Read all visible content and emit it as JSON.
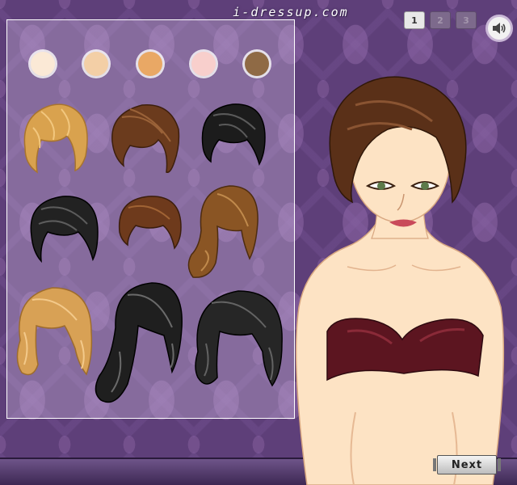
{
  "site": {
    "logo_text": "i-dressup.com"
  },
  "pager": {
    "pages": [
      "1",
      "2",
      "3"
    ],
    "active": "1"
  },
  "sound": {
    "icon": "speaker-icon"
  },
  "panel": {
    "skin_tones": [
      {
        "name": "skin-tone-1",
        "color": "#fbe9d6"
      },
      {
        "name": "skin-tone-2",
        "color": "#f3cfa6"
      },
      {
        "name": "skin-tone-3",
        "color": "#e9a865"
      },
      {
        "name": "skin-tone-4",
        "color": "#f8cfcc"
      },
      {
        "name": "skin-tone-5",
        "color": "#8f6a45"
      }
    ],
    "hair_options": [
      {
        "name": "hair-option-1",
        "color": "#d9a24e"
      },
      {
        "name": "hair-option-2",
        "color": "#6b3b1d"
      },
      {
        "name": "hair-option-3",
        "color": "#1c1c1c"
      },
      {
        "name": "hair-option-4",
        "color": "#222222"
      },
      {
        "name": "hair-option-5",
        "color": "#6e3a1c"
      },
      {
        "name": "hair-option-6",
        "color": "#8a5524"
      },
      {
        "name": "hair-option-7",
        "color": "#d8a155"
      },
      {
        "name": "hair-option-8",
        "color": "#1f1f1f"
      },
      {
        "name": "hair-option-9",
        "color": "#262626"
      }
    ]
  },
  "model": {
    "hair_color": "#5a3018",
    "top_color": "#5c1520",
    "skin_color": "#fde3c4"
  },
  "next_button": {
    "label": "Next"
  }
}
